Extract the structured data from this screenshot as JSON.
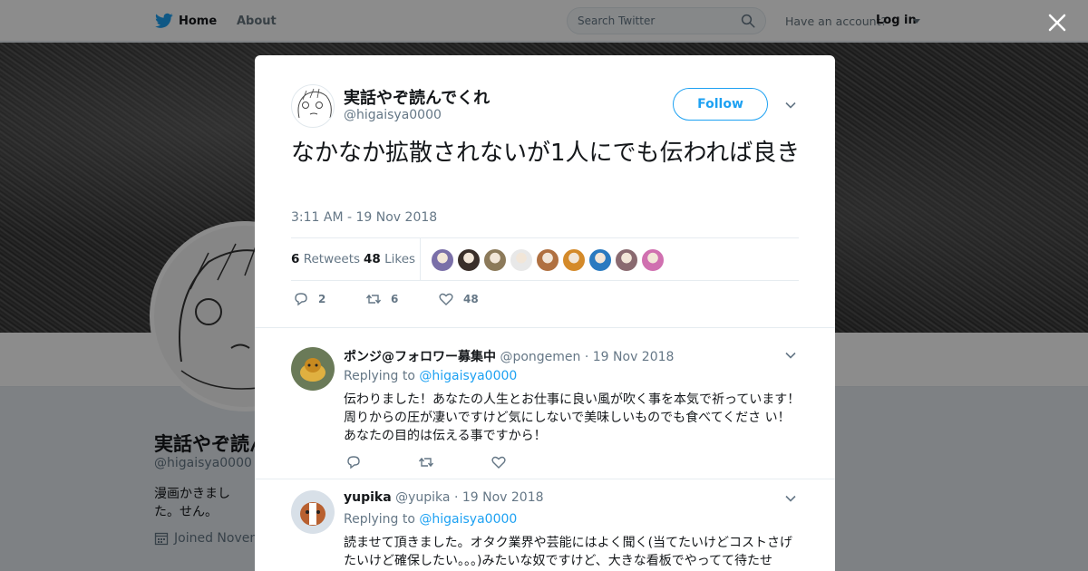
{
  "nav": {
    "home": "Home",
    "about": "About",
    "search_placeholder": "Search Twitter",
    "have_account": "Have an account?",
    "login": "Log in"
  },
  "background_profile": {
    "name": "実話やぞ読んでくれ",
    "handle": "@higaisya0000",
    "bio": "漫画かきました。せん。",
    "joined": "Joined Novem"
  },
  "tweet": {
    "author_name": "実話やぞ読んでくれ",
    "author_handle": "@higaisya0000",
    "follow_label": "Follow",
    "text": "なかなか拡散されないが1人にでも伝われば良き",
    "timestamp": "3:11 AM - 19 Nov 2018",
    "retweets_count": "6",
    "retweets_label": "Retweets",
    "likes_count": "48",
    "likes_label": "Likes",
    "reply_count": "2",
    "retweet_action_count": "6",
    "like_action_count": "48",
    "liker_colors": [
      "#7a6fa8",
      "#3a2f2a",
      "#8c7a5a",
      "#e8e8e8",
      "#b07040",
      "#d48a2a",
      "#2a7ac0",
      "#8a6a70",
      "#d070b0"
    ]
  },
  "replies": [
    {
      "name": "ポンジ@フォロワー募集中",
      "handle": "@pongemen",
      "date": "· 19 Nov 2018",
      "replying_prefix": "Replying to",
      "replying_to": "@higaisya0000",
      "text": "伝わりました！あなたの人生とお仕事に良い風が吹く事を本気で祈っています！ 周りからの圧が凄いですけど気にしないで美味しいものでも食べてくださ い！ あなたの目的は伝える事ですから！",
      "avatar_color": "#c8a040"
    },
    {
      "name": "yupika",
      "handle": "@yupika",
      "date": "· 19 Nov 2018",
      "replying_prefix": "Replying to",
      "replying_to": "@higaisya0000",
      "text": "読ませて頂きました。オタク業界や芸能にはよく聞く(当てたいけどコストさげたいけど確保したい。。。)みたいな奴ですけど、大きな看板でやってて待たせ",
      "avatar_color": "#b86030"
    }
  ]
}
